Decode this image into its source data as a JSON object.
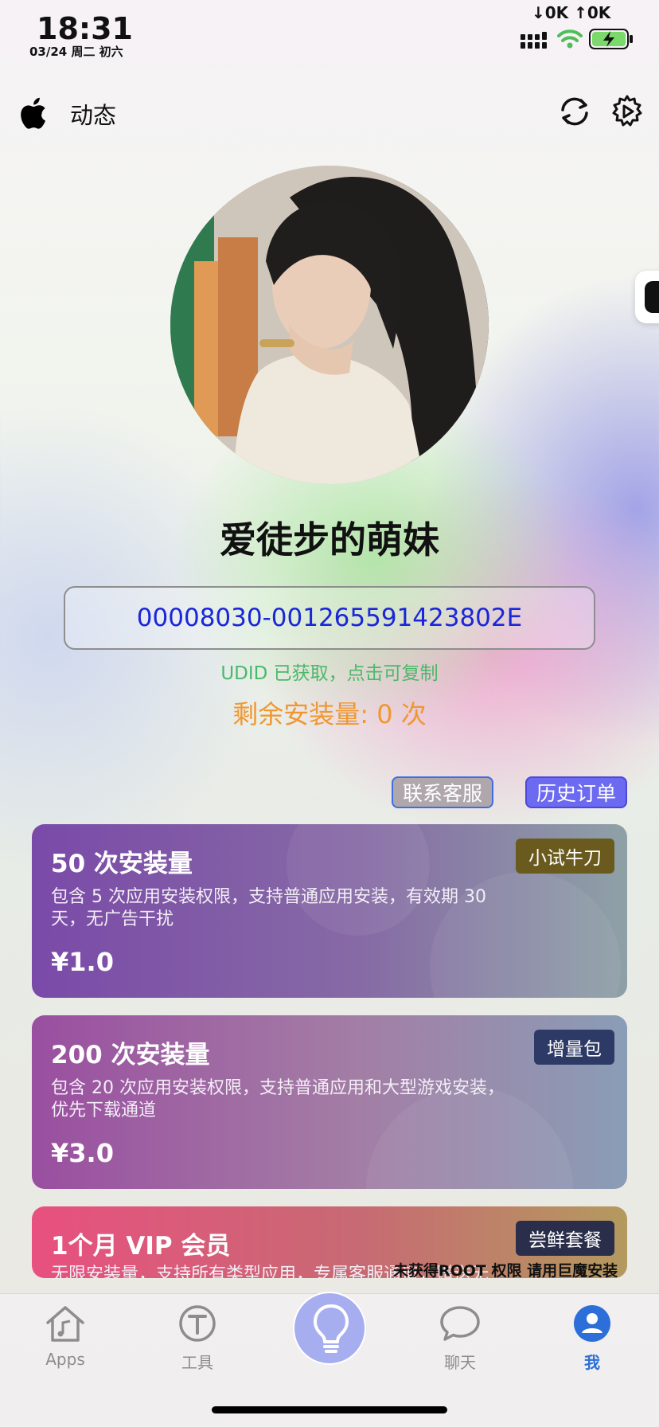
{
  "status_bar": {
    "time": "18:31",
    "date": "03/24 周二 初六",
    "net_speed": "↓0K ↑0K",
    "battery_level": "96"
  },
  "header": {
    "title": "动态"
  },
  "profile": {
    "name": "爱徒步的萌妹",
    "udid": "00008030-001265591423802E",
    "udid_hint": "UDID 已获取，点击可复制",
    "remaining": "剩余安装量: 0 次"
  },
  "actions": {
    "contact": "联系客服",
    "history": "历史订单"
  },
  "plans": [
    {
      "title": "50 次安装量",
      "badge": "小试牛刀",
      "desc_line1": "包含 5 次应用安装权限，支持普通应用安装，有效期 30",
      "desc_line2": "天，无广告干扰",
      "price": "¥1.0"
    },
    {
      "title": "200 次安装量",
      "badge": "增量包",
      "desc_line1": "包含 20 次应用安装权限，支持普通应用和大型游戏安装，",
      "desc_line2": "优先下载通道",
      "price": "¥3.0"
    },
    {
      "title": "1个月 VIP 会员",
      "badge": "尝鲜套餐",
      "desc_line1": "无限安装量，支持所有类型应用，专属客服通道，赠送无"
    }
  ],
  "notice": "未获得ROOT 权限 请用巨魔安装",
  "tabbar": {
    "apps": "Apps",
    "tools": "工具",
    "chat": "聊天",
    "me": "我"
  },
  "colors": {
    "udid": "#1a26d8",
    "udid_hint": "#4cb86a",
    "remaining": "#f0972f",
    "active_tab": "#2c6fd8"
  }
}
